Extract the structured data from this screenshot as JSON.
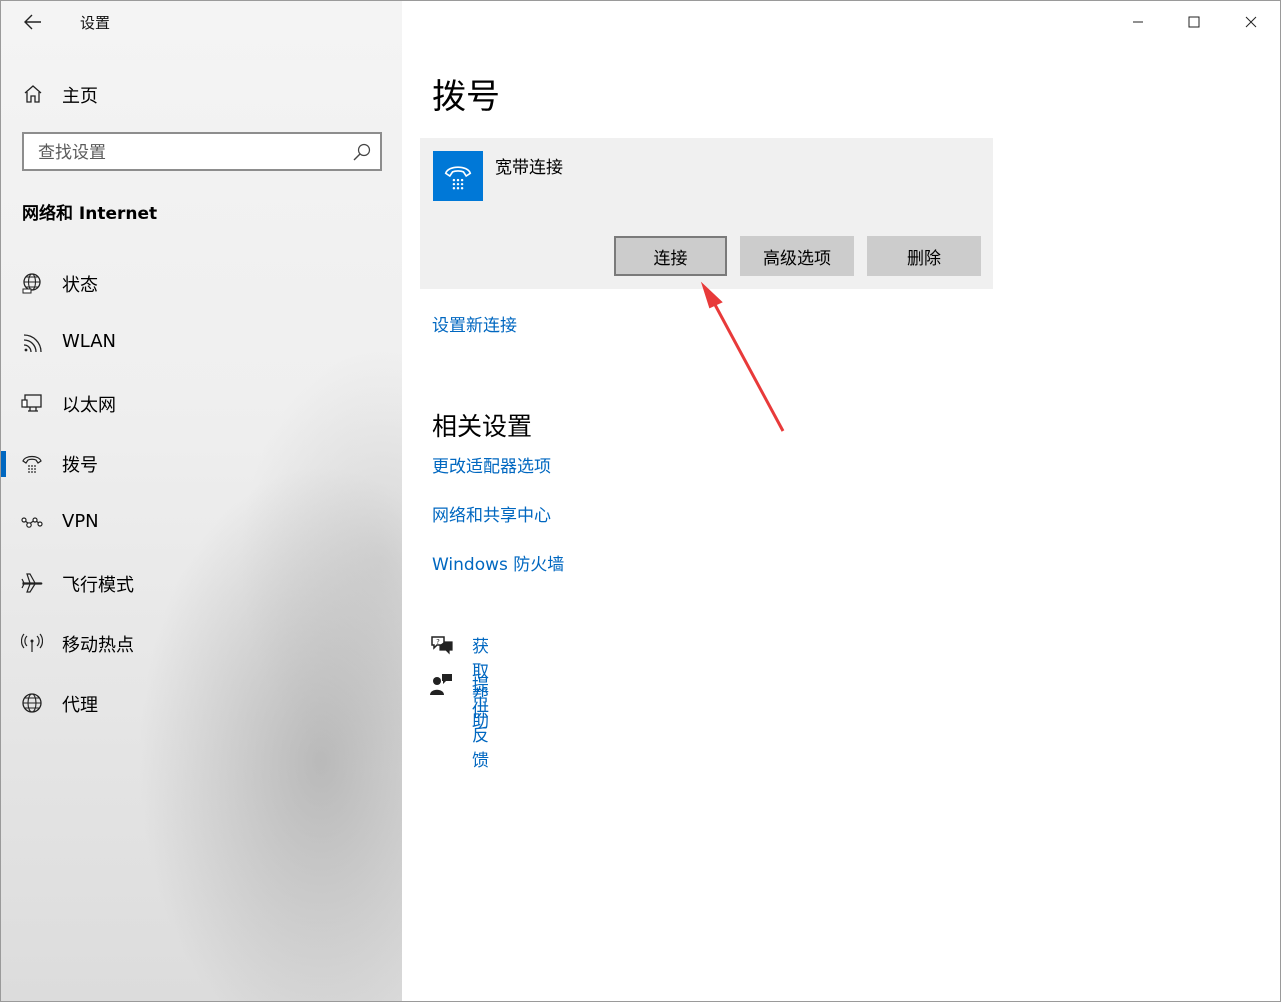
{
  "window": {
    "app_title": "设置"
  },
  "sidebar": {
    "home_label": "主页",
    "search_placeholder": "查找设置",
    "section_title": "网络和 Internet",
    "items": [
      {
        "label": "状态",
        "icon": "globe-status-icon"
      },
      {
        "label": "WLAN",
        "icon": "wifi-icon"
      },
      {
        "label": "以太网",
        "icon": "ethernet-icon"
      },
      {
        "label": "拨号",
        "icon": "dialup-phone-icon",
        "active": true
      },
      {
        "label": "VPN",
        "icon": "vpn-icon"
      },
      {
        "label": "飞行模式",
        "icon": "airplane-icon"
      },
      {
        "label": "移动热点",
        "icon": "hotspot-icon"
      },
      {
        "label": "代理",
        "icon": "globe-icon"
      }
    ]
  },
  "main": {
    "title": "拨号",
    "connection": {
      "name": "宽带连接",
      "buttons": {
        "connect": "连接",
        "advanced": "高级选项",
        "delete": "删除"
      }
    },
    "new_connection_link": "设置新连接",
    "related": {
      "title": "相关设置",
      "links": [
        "更改适配器选项",
        "网络和共享中心",
        "Windows 防火墙"
      ]
    },
    "help": {
      "get_help": "获取帮助",
      "feedback": "提供反馈"
    }
  },
  "colors": {
    "accent": "#0067c0",
    "icon_tile": "#0078d7",
    "annotation_arrow": "#e83a3a"
  }
}
